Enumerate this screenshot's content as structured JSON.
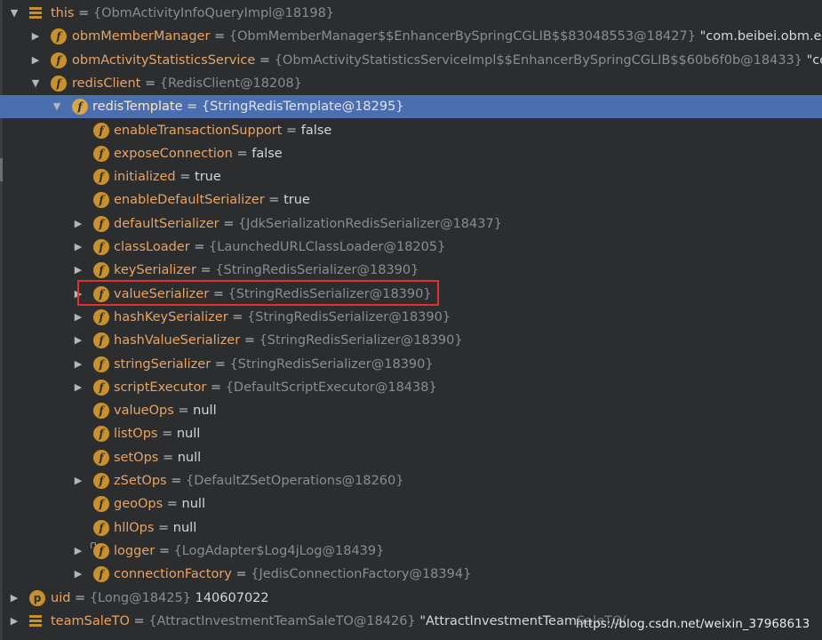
{
  "variables": [
    {
      "arrow": "▼",
      "icon": "list",
      "name": "this",
      "ref": "{ObmActivityInfoQueryImpl@18198}",
      "value": ""
    },
    {
      "arrow": "▶",
      "icon": "f",
      "name": "obmMemberManager",
      "ref": "{ObmMemberManager$$EnhancerBySpringCGLIB$$83048553@18427}",
      "value": "\"com.beibei.obm.ex"
    },
    {
      "arrow": "▶",
      "icon": "f",
      "name": "obmActivityStatisticsService",
      "ref": "{ObmActivityStatisticsServiceImpl$$EnhancerBySpringCGLIB$$60b6f0b@18433}",
      "value": "\"com."
    },
    {
      "arrow": "▼",
      "icon": "f",
      "name": "redisClient",
      "ref": "{RedisClient@18208}",
      "value": ""
    },
    {
      "arrow": "▼",
      "icon": "f",
      "name": "redisTemplate",
      "ref": "{StringRedisTemplate@18295}",
      "value": ""
    },
    {
      "arrow": "",
      "icon": "f",
      "name": "enableTransactionSupport",
      "ref": "",
      "value": "false"
    },
    {
      "arrow": "",
      "icon": "f",
      "name": "exposeConnection",
      "ref": "",
      "value": "false"
    },
    {
      "arrow": "",
      "icon": "f",
      "name": "initialized",
      "ref": "",
      "value": "true"
    },
    {
      "arrow": "",
      "icon": "f",
      "name": "enableDefaultSerializer",
      "ref": "",
      "value": "true"
    },
    {
      "arrow": "▶",
      "icon": "f",
      "name": "defaultSerializer",
      "ref": "{JdkSerializationRedisSerializer@18437}",
      "value": ""
    },
    {
      "arrow": "▶",
      "icon": "f",
      "name": "classLoader",
      "ref": "{LaunchedURLClassLoader@18205}",
      "value": ""
    },
    {
      "arrow": "▶",
      "icon": "f",
      "name": "keySerializer",
      "ref": "{StringRedisSerializer@18390}",
      "value": ""
    },
    {
      "arrow": "▶",
      "icon": "f",
      "name": "valueSerializer",
      "ref": "{StringRedisSerializer@18390}",
      "value": ""
    },
    {
      "arrow": "▶",
      "icon": "f",
      "name": "hashKeySerializer",
      "ref": "{StringRedisSerializer@18390}",
      "value": ""
    },
    {
      "arrow": "▶",
      "icon": "f",
      "name": "hashValueSerializer",
      "ref": "{StringRedisSerializer@18390}",
      "value": ""
    },
    {
      "arrow": "▶",
      "icon": "f",
      "name": "stringSerializer",
      "ref": "{StringRedisSerializer@18390}",
      "value": ""
    },
    {
      "arrow": "▶",
      "icon": "f",
      "name": "scriptExecutor",
      "ref": "{DefaultScriptExecutor@18438}",
      "value": ""
    },
    {
      "arrow": "",
      "icon": "f",
      "name": "valueOps",
      "ref": "",
      "value": "null"
    },
    {
      "arrow": "",
      "icon": "f",
      "name": "listOps",
      "ref": "",
      "value": "null"
    },
    {
      "arrow": "",
      "icon": "f",
      "name": "setOps",
      "ref": "",
      "value": "null"
    },
    {
      "arrow": "▶",
      "icon": "f",
      "name": "zSetOps",
      "ref": "{DefaultZSetOperations@18260}",
      "value": ""
    },
    {
      "arrow": "",
      "icon": "f",
      "name": "geoOps",
      "ref": "",
      "value": "null"
    },
    {
      "arrow": "",
      "icon": "f",
      "name": "hllOps",
      "ref": "",
      "value": "null"
    },
    {
      "arrow": "▶",
      "icon": "f-lock",
      "name": "logger",
      "ref": "{LogAdapter$Log4jLog@18439}",
      "value": ""
    },
    {
      "arrow": "▶",
      "icon": "f",
      "name": "connectionFactory",
      "ref": "{JedisConnectionFactory@18394}",
      "value": ""
    },
    {
      "arrow": "▶",
      "icon": "p",
      "name": "uid",
      "ref": "{Long@18425}",
      "value": "140607022"
    },
    {
      "arrow": "▶",
      "icon": "list",
      "name": "teamSaleTO",
      "ref": "{AttractInvestmentTeamSaleTO@18426}",
      "value": "\"AttractInvestmentTeamSaleTO("
    }
  ],
  "selected_variable": "redisTemplate",
  "highlighted_variable": "valueSerializer",
  "icon_letters": {
    "field": "f",
    "parameter": "p"
  },
  "eq_sign": "=",
  "watermark": "https://blog.csdn.net/weixin_37968613",
  "colors": {
    "background": "#2b2d2f",
    "selection": "#4b6eaf",
    "field_name": "#e8a467",
    "icon": "#c9912d",
    "highlight_box": "#e03030"
  }
}
